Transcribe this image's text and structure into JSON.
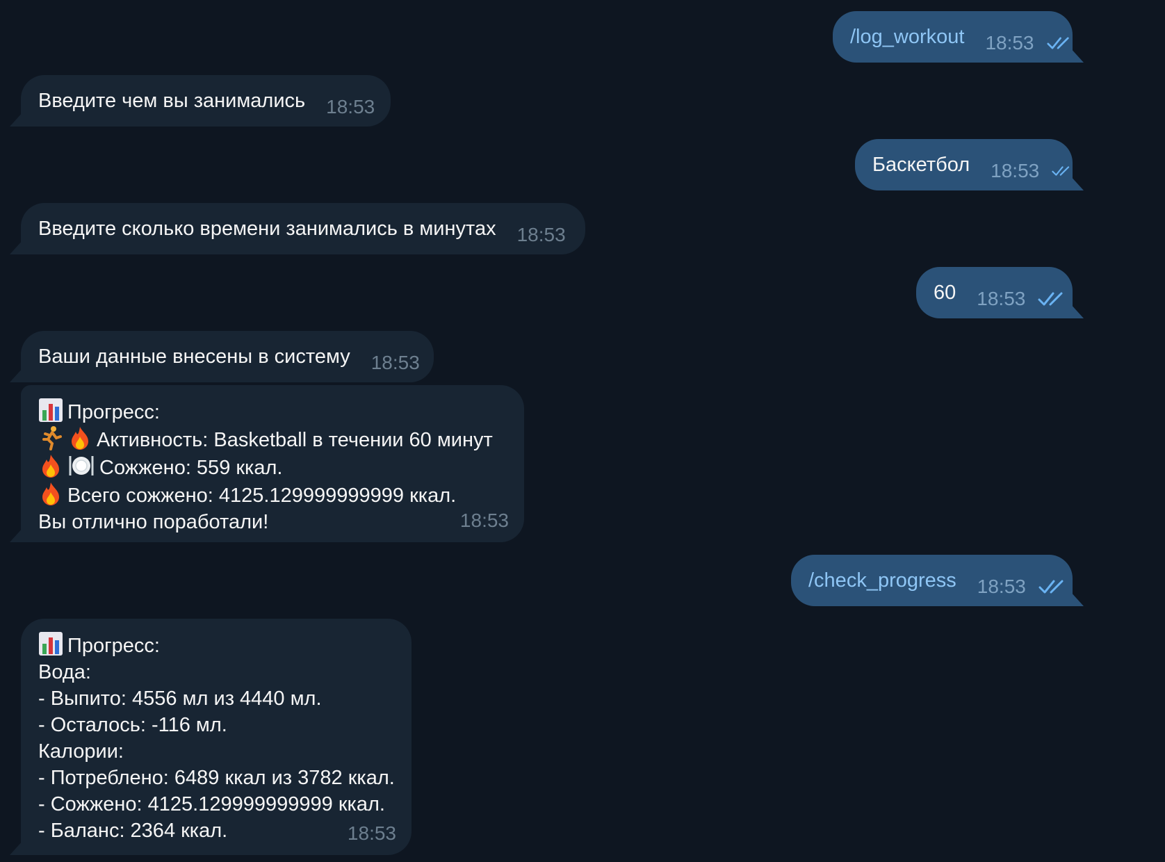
{
  "messages": [
    {
      "direction": "out",
      "text": "/log_workout",
      "time": "18:53",
      "command": true
    },
    {
      "direction": "in",
      "text": "Введите чем вы занимались",
      "time": "18:53"
    },
    {
      "direction": "out",
      "text": "Баскетбол",
      "time": "18:53",
      "command": false
    },
    {
      "direction": "in",
      "text": "Введите сколько времени занимались в минутах",
      "time": "18:53"
    },
    {
      "direction": "out",
      "text": "60",
      "time": "18:53",
      "command": false
    },
    {
      "direction": "in",
      "text": "Ваши данные внесены в систему",
      "time": "18:53"
    },
    {
      "direction": "in",
      "time": "18:53",
      "lines": [
        {
          "icons": [
            "chart-emoji"
          ],
          "text": "Прогресс:"
        },
        {
          "icons": [
            "runner-emoji",
            "fire-emoji"
          ],
          "text": "Активность: Basketball в течении 60 минут"
        },
        {
          "icons": [
            "fire-emoji",
            "plate-emoji"
          ],
          "text": "Сожжено: 559 ккал."
        },
        {
          "icons": [
            "fire-emoji"
          ],
          "text": "Всего сожжено: 4125.129999999999 ккал."
        },
        {
          "icons": [],
          "text": "Вы отлично поработали!"
        }
      ]
    },
    {
      "direction": "out",
      "text": "/check_progress",
      "time": "18:53",
      "command": true
    },
    {
      "direction": "in",
      "time": "18:53",
      "lines": [
        {
          "icons": [
            "chart-emoji"
          ],
          "text": "Прогресс:"
        },
        {
          "icons": [],
          "text": "Вода:"
        },
        {
          "icons": [],
          "text": "- Выпито: 4556 мл из 4440 мл."
        },
        {
          "icons": [],
          "text": "- Осталось: -116 мл."
        },
        {
          "icons": [],
          "text": "Калории:"
        },
        {
          "icons": [],
          "text": "- Потреблено: 6489 ккал из 3782 ккал."
        },
        {
          "icons": [],
          "text": "- Сожжено: 4125.129999999999 ккал."
        },
        {
          "icons": [],
          "text": "- Баланс: 2364 ккал."
        }
      ]
    }
  ],
  "colors": {
    "background": "#0e1621",
    "incoming_bubble": "#182533",
    "outgoing_bubble": "#2b5278",
    "command_text": "#8fc6f5",
    "read_checks": "#6ab3f3"
  }
}
